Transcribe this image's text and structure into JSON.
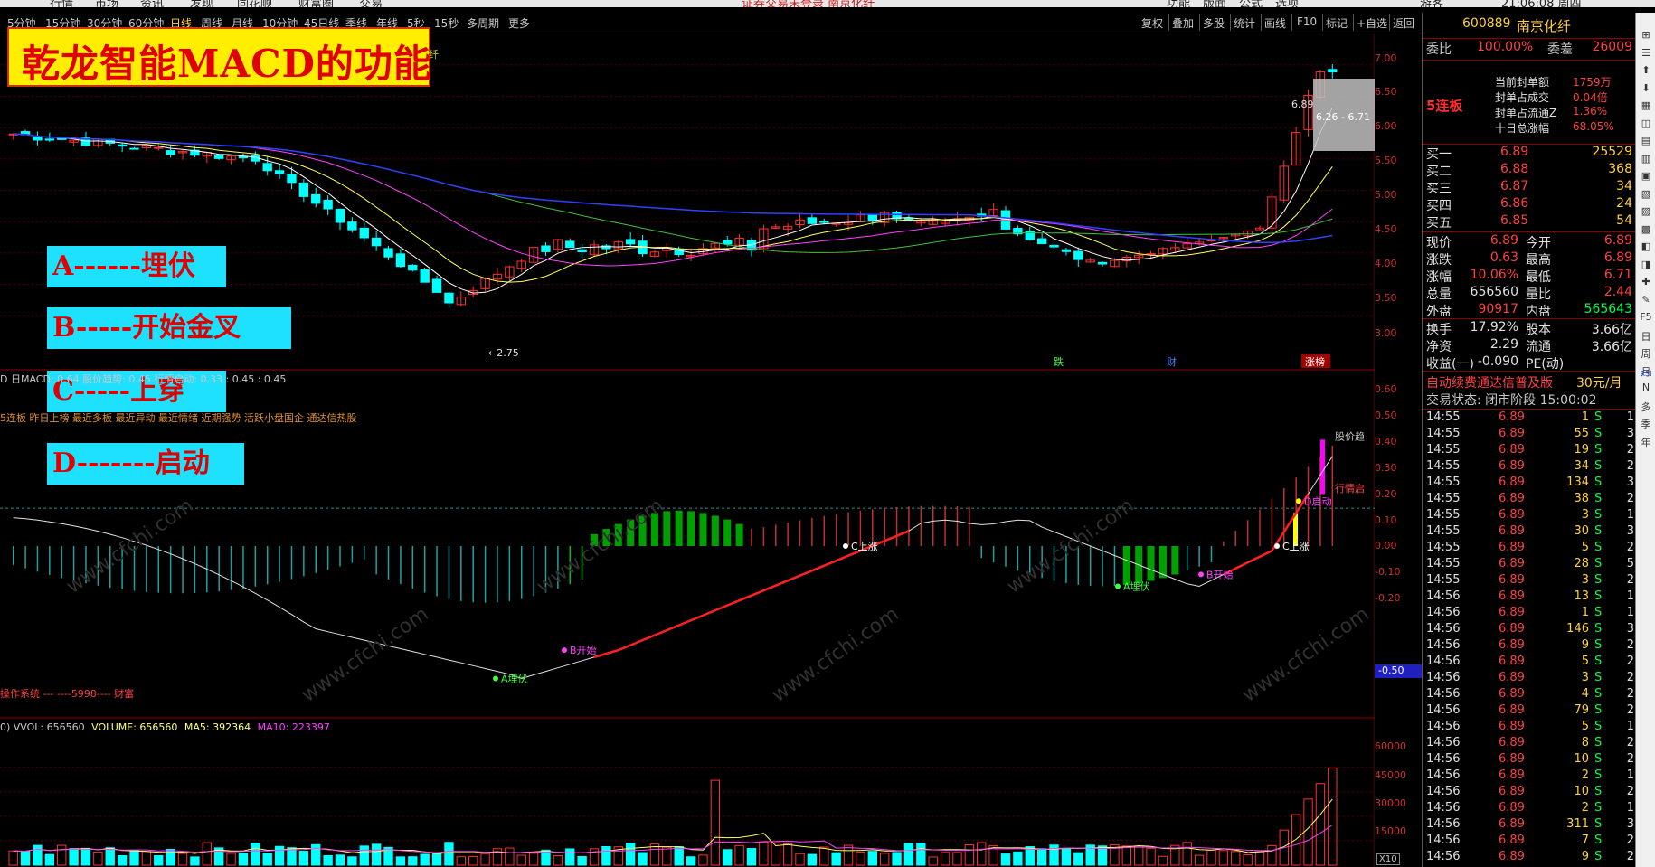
{
  "menubar": {
    "items": [
      "行情",
      "市场",
      "资讯",
      "发现",
      "同花顺",
      "财富圈",
      "交易"
    ],
    "center": "证券交易未登录  南京化纤",
    "right": [
      "功能",
      "版面",
      "公式",
      "选项"
    ],
    "clock": "21:06:08 周四",
    "helper": "游客"
  },
  "periods": [
    "5分钟",
    "15分钟",
    "30分钟",
    "60分钟",
    "日线",
    "周线",
    "月线",
    "10分钟",
    "45日线",
    "季线",
    "年线",
    "5秒",
    "15秒",
    "多周期",
    "更多"
  ],
  "active_period": "日线",
  "tools": [
    "复权",
    "叠加",
    "多股",
    "统计",
    "画线",
    "F10",
    "标记",
    "+自选",
    "返回"
  ],
  "banner_title": "乾龙智能MACD的功能",
  "banner_tail": "纤",
  "labels": [
    "A------埋伏",
    "B-----开始金叉",
    "C-----上穿",
    "D-------启动"
  ],
  "price_axis": [
    "7.00",
    "6.50",
    "6.00",
    "5.50",
    "5.00",
    "4.50",
    "4.00",
    "3.50",
    "3.00"
  ],
  "macd_axis": [
    "0.60",
    "0.50",
    "0.40",
    "0.30",
    "0.20",
    "0.10",
    "0.00",
    "-0.10",
    "-0.20"
  ],
  "macd_current": "-0.50",
  "vol_axis": [
    "60000",
    "45000",
    "30000",
    "15000"
  ],
  "vol_unit": "X10",
  "price_marks": {
    "high": "6.89",
    "range": "6.26 - 6.71",
    "low": "2.75"
  },
  "event_tags": [
    "跌",
    "财",
    "涨榜"
  ],
  "macd_header": "D  日MACD: 0.64  股价趋势: 0.45  行情启动: 0.33 : 0.45 : 0.45",
  "macd_subheader": "5连板 昨日上榜 最近多板 最近异动 最近情绪 近期强势 活跃小盘国企 通达信热股",
  "macd_right_labels": [
    "股价趋",
    "行情启"
  ],
  "macd_signals": {
    "a": "A埋伏",
    "b": "B开始",
    "c": "C上涨",
    "d": "D启动",
    "a2": "A埋伏",
    "b2": "B开始",
    "c2": "C上涨"
  },
  "macd_footer": "操作系统  --- ----5998---- 财富",
  "vol_header": {
    "a": "0)  VVOL: 656560",
    "b": "VOLUME: 656560",
    "c": "MA5: 392364",
    "d": "MA10: 223397"
  },
  "quote": {
    "code": "600889",
    "name": "南京化纤",
    "wb_label": "委比",
    "wb_pct": "100.00%",
    "wc_label": "委差",
    "wc_val": "26009",
    "streak": "5连板",
    "seal": [
      {
        "k": "当前封单额",
        "v": "1759万"
      },
      {
        "k": "封单占成交",
        "v": "0.04倍"
      },
      {
        "k": "封单占流通Z",
        "v": "1.36%"
      },
      {
        "k": "十日总涨幅",
        "v": "68.05%"
      }
    ],
    "bids": [
      {
        "k": "买一",
        "p": "6.89",
        "v": "25529"
      },
      {
        "k": "买二",
        "p": "6.88",
        "v": "368"
      },
      {
        "k": "买三",
        "p": "6.87",
        "v": "34"
      },
      {
        "k": "买四",
        "p": "6.86",
        "v": "24"
      },
      {
        "k": "买五",
        "p": "6.85",
        "v": "54"
      }
    ],
    "stats": [
      {
        "k": "现价",
        "v": "6.89",
        "k2": "今开",
        "v2": "6.89"
      },
      {
        "k": "涨跌",
        "v": "0.63",
        "k2": "最高",
        "v2": "6.89"
      },
      {
        "k": "涨幅",
        "v": "10.06%",
        "k2": "最低",
        "v2": "6.71"
      },
      {
        "k": "总量",
        "v": "656560",
        "k2": "量比",
        "v2": "2.44"
      },
      {
        "k": "外盘",
        "v": "90917",
        "k2": "内盘",
        "v2": "565643"
      }
    ],
    "stats2": [
      {
        "k": "换手",
        "v": "17.92%",
        "k2": "股本",
        "v2": "3.66亿"
      },
      {
        "k": "净资",
        "v": "2.29",
        "k2": "流通",
        "v2": "3.66亿"
      },
      {
        "k": "收益(一)",
        "v": "-0.090",
        "k2": "PE(动)",
        "v2": ""
      }
    ],
    "promo": "自动续费通达信普及版",
    "promo_price": "30元/月",
    "trade_status": "交易状态: 闭市阶段 15:00:02"
  },
  "ticks": [
    [
      "14:55",
      "6.89",
      "1",
      "S",
      "1"
    ],
    [
      "14:55",
      "6.89",
      "55",
      "S",
      "3"
    ],
    [
      "14:55",
      "6.89",
      "19",
      "S",
      "2"
    ],
    [
      "14:55",
      "6.89",
      "34",
      "S",
      "2"
    ],
    [
      "14:55",
      "6.89",
      "134",
      "S",
      "3"
    ],
    [
      "14:55",
      "6.89",
      "38",
      "S",
      "2"
    ],
    [
      "14:55",
      "6.89",
      "3",
      "S",
      "1"
    ],
    [
      "14:55",
      "6.89",
      "30",
      "S",
      "3"
    ],
    [
      "14:55",
      "6.89",
      "5",
      "S",
      "2"
    ],
    [
      "14:55",
      "6.89",
      "28",
      "S",
      "5"
    ],
    [
      "14:55",
      "6.89",
      "3",
      "S",
      "2"
    ],
    [
      "14:56",
      "6.89",
      "13",
      "S",
      "1"
    ],
    [
      "14:56",
      "6.89",
      "1",
      "S",
      "1"
    ],
    [
      "14:56",
      "6.89",
      "146",
      "S",
      "3"
    ],
    [
      "14:56",
      "6.89",
      "9",
      "S",
      "2"
    ],
    [
      "14:56",
      "6.89",
      "5",
      "S",
      "2"
    ],
    [
      "14:56",
      "6.89",
      "3",
      "S",
      "2"
    ],
    [
      "14:56",
      "6.89",
      "4",
      "S",
      "2"
    ],
    [
      "14:56",
      "6.89",
      "79",
      "S",
      "2"
    ],
    [
      "14:56",
      "6.89",
      "5",
      "S",
      "1"
    ],
    [
      "14:56",
      "6.89",
      "8",
      "S",
      "2"
    ],
    [
      "14:56",
      "6.89",
      "10",
      "S",
      "2"
    ],
    [
      "14:56",
      "6.89",
      "2",
      "S",
      "1"
    ],
    [
      "14:56",
      "6.89",
      "10",
      "S",
      "2"
    ],
    [
      "14:56",
      "6.89",
      "2",
      "S",
      "1"
    ],
    [
      "14:56",
      "6.89",
      "311",
      "S",
      "3"
    ],
    [
      "14:56",
      "6.89",
      "7",
      "S",
      "2"
    ],
    [
      "14:56",
      "6.89",
      "9",
      "S",
      "2"
    ]
  ],
  "sidebar": [
    "⊞",
    "☰",
    "⬆",
    "⬇",
    "▦",
    "◫",
    "▤",
    "▥",
    "▣",
    "▧",
    "▨",
    "▩",
    "◧",
    "◨",
    "✚",
    "✎",
    "F5",
    "日",
    "周",
    "月",
    "N",
    "多",
    "季",
    "年"
  ],
  "sidebar_rsi": "RSI",
  "colors": {
    "up": "#ff4040",
    "down": "#00ffff",
    "macd_red": "#ff2020",
    "macd_green": "#00c000",
    "macd_magenta": "#ff00ff",
    "label_bg": "#1ee0ff",
    "banner_bg": "#ffee00"
  }
}
